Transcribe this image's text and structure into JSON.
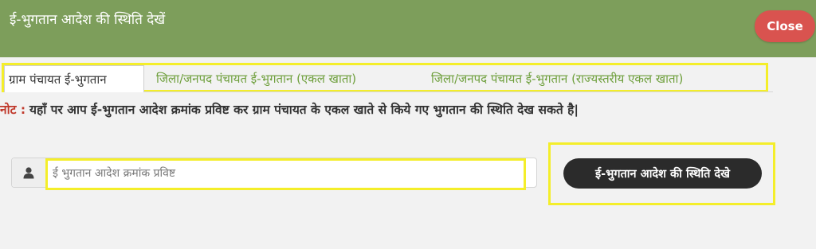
{
  "header": {
    "title": "ई-भुगतान आदेश की स्थिति देखें",
    "close_label": "Close",
    "bg_color": "#7d9e5b",
    "close_color": "#d9534f"
  },
  "tabs": [
    {
      "label": "ग्राम पंचायत ई-भुगतान",
      "active": true
    },
    {
      "label": "जिला/जनपद पंचायत ई-भुगतान (एकल खाता)",
      "active": false
    },
    {
      "label": "जिला/जनपद पंचायत ई-भुगतान (राज्यस्तरीय एकल खाता)",
      "active": false
    }
  ],
  "note": {
    "label": "नोट :",
    "text": "यहाँ पर आप ई-भुगतान आदेश क्रमांक प्रविष्ट कर ग्राम पंचायत के एकल खाते से किये गए भुगतान की स्थिति देख सकते है|"
  },
  "search": {
    "icon": "user-icon",
    "placeholder": "ई भुगतान आदेश क्रमांक प्रविष्ट",
    "value": ""
  },
  "status_button": {
    "label": "ई-भुगतान आदेश की स्थिति देखे"
  },
  "highlight_color": "#f4ee2a"
}
